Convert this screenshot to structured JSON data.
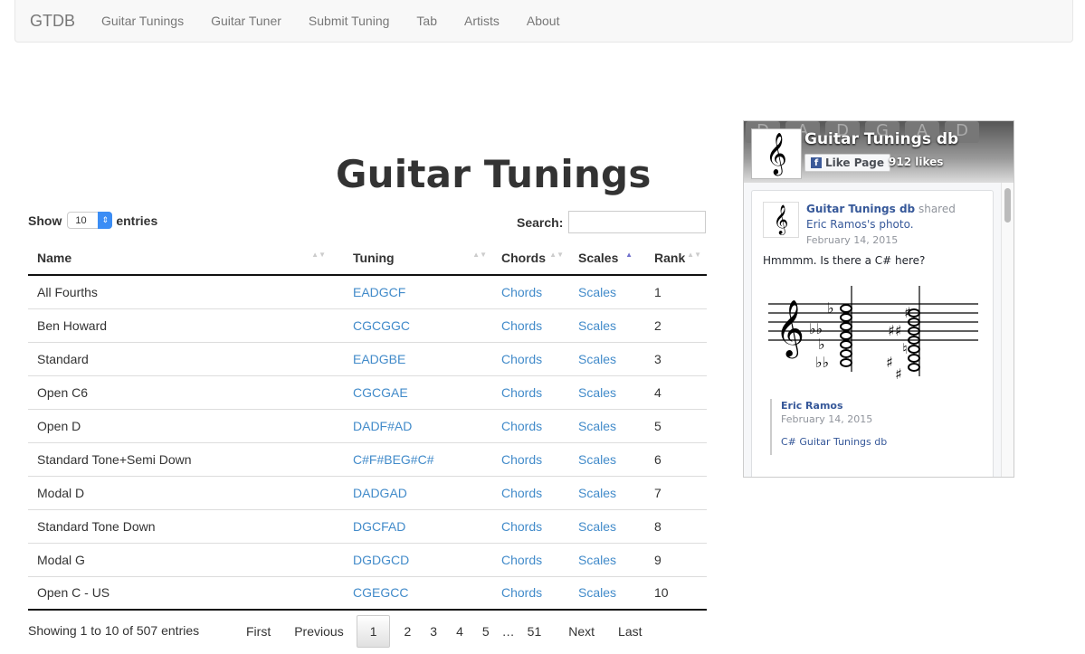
{
  "navbar": {
    "brand": "GTDB",
    "links": [
      "Guitar Tunings",
      "Guitar Tuner",
      "Submit Tuning",
      "Tab",
      "Artists",
      "About"
    ]
  },
  "page": {
    "title": "Guitar Tunings"
  },
  "length": {
    "show_label": "Show",
    "value": "10",
    "entries_label": "entries"
  },
  "search": {
    "label": "Search:",
    "value": "",
    "placeholder": ""
  },
  "table": {
    "columns": [
      {
        "label": "Name",
        "sort": "none"
      },
      {
        "label": "Tuning",
        "sort": "none"
      },
      {
        "label": "Chords",
        "sort": "none"
      },
      {
        "label": "Scales",
        "sort": "asc"
      },
      {
        "label": "Rank",
        "sort": "none"
      }
    ],
    "rows": [
      {
        "name": "All Fourths",
        "tuning": "EADGCF",
        "chords": "Chords",
        "scales": "Scales",
        "rank": "1"
      },
      {
        "name": "Ben Howard",
        "tuning": "CGCGGC",
        "chords": "Chords",
        "scales": "Scales",
        "rank": "2"
      },
      {
        "name": "Standard",
        "tuning": "EADGBE",
        "chords": "Chords",
        "scales": "Scales",
        "rank": "3"
      },
      {
        "name": "Open C6",
        "tuning": "CGCGAE",
        "chords": "Chords",
        "scales": "Scales",
        "rank": "4"
      },
      {
        "name": "Open D",
        "tuning": "DADF#AD",
        "chords": "Chords",
        "scales": "Scales",
        "rank": "5"
      },
      {
        "name": "Standard Tone+Semi Down",
        "tuning": "C#F#BEG#C#",
        "chords": "Chords",
        "scales": "Scales",
        "rank": "6"
      },
      {
        "name": "Modal D",
        "tuning": "DADGAD",
        "chords": "Chords",
        "scales": "Scales",
        "rank": "7"
      },
      {
        "name": "Standard Tone Down",
        "tuning": "DGCFAD",
        "chords": "Chords",
        "scales": "Scales",
        "rank": "8"
      },
      {
        "name": "Modal G",
        "tuning": "DGDGCD",
        "chords": "Chords",
        "scales": "Scales",
        "rank": "9"
      },
      {
        "name": "Open C - US",
        "tuning": "CGEGCC",
        "chords": "Chords",
        "scales": "Scales",
        "rank": "10"
      }
    ]
  },
  "info": "Showing 1 to 10 of 507 entries",
  "pagination": {
    "first": "First",
    "previous": "Previous",
    "pages": [
      "1",
      "2",
      "3",
      "4",
      "5"
    ],
    "current": "1",
    "ellipsis": "…",
    "last_page": "51",
    "next": "Next",
    "last": "Last"
  },
  "facebook": {
    "page_name": "Guitar Tunings db",
    "like_button": "Like Page",
    "likes": "912 likes",
    "cover_letters": [
      "D",
      "A",
      "D",
      "G",
      "A",
      "D"
    ],
    "post": {
      "author": "Guitar Tunings db",
      "action": "shared",
      "shared_link": "Eric Ramos's photo.",
      "date": "February 14, 2015",
      "message": "Hmmmm. Is there a C# here?",
      "quote_author": "Eric Ramos",
      "quote_date": "February 14, 2015",
      "quote_text": "C# Guitar Tunings db"
    },
    "brand_color": "#3b5998",
    "link_color": "#365899"
  },
  "colors": {
    "link": "#428bca",
    "sort_active": "#7070cc"
  }
}
